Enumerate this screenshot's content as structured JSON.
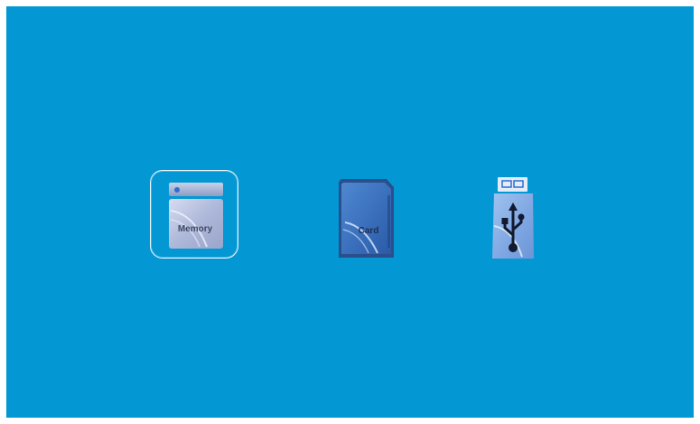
{
  "screen": {
    "background": "#0398d4",
    "selected_index": 0
  },
  "sources": [
    {
      "id": "memory",
      "label": "Memory",
      "icon": "internal-memory-icon",
      "selected": true
    },
    {
      "id": "card",
      "label": "Card",
      "icon": "sd-card-icon",
      "selected": false
    },
    {
      "id": "usb",
      "label": "",
      "icon": "usb-drive-icon",
      "selected": false
    }
  ],
  "colors": {
    "selection_border": "#ffffff",
    "memory_body": "#a9b4d6",
    "card_body": "#3b74c0",
    "usb_body": "#86aee6"
  }
}
